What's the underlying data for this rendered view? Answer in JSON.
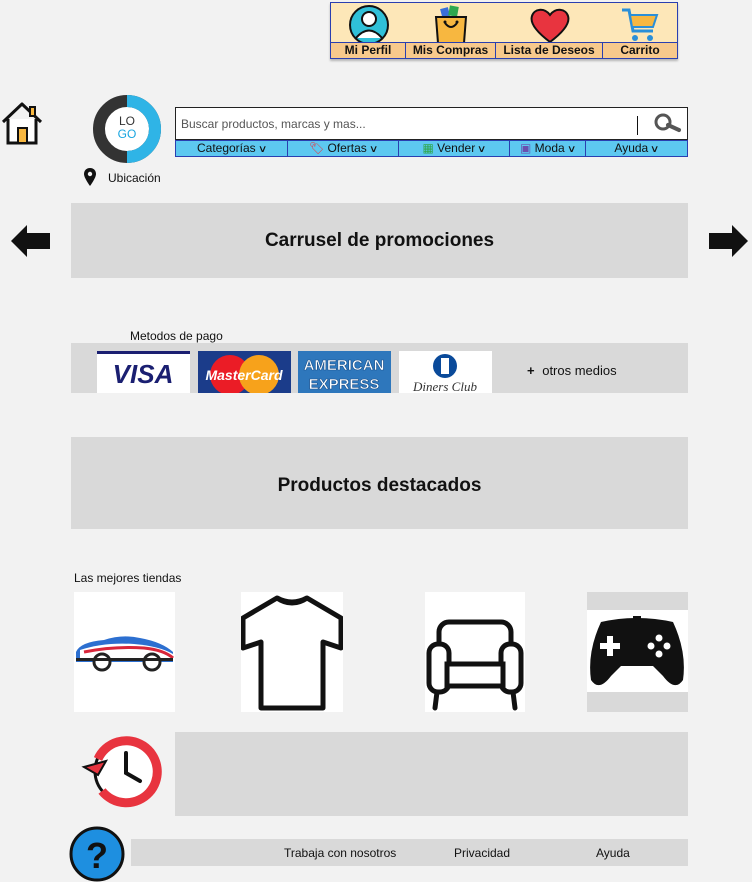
{
  "user_bar": {
    "profile": "Mi Perfil",
    "purchases": "Mis Compras",
    "wishlist": "Lista de Deseos",
    "cart": "Carrito"
  },
  "logo": {
    "line1": "LO",
    "line2": "GO"
  },
  "location": "Ubicación",
  "search": {
    "placeholder": "Buscar productos, marcas y mas..."
  },
  "nav": {
    "categories": "Categorías",
    "offers": "Ofertas",
    "sell": "Vender",
    "fashion": "Moda",
    "help": "Ayuda"
  },
  "carousel": {
    "title": "Carrusel de promociones"
  },
  "payment": {
    "label": "Metodos de pago",
    "cards": [
      "VISA",
      "MasterCard",
      "AMERICAN EXPRESS",
      "Diners Club"
    ],
    "more": "otros medios"
  },
  "featured": {
    "title": "Productos destacados"
  },
  "stores": {
    "label": "Las mejores tiendas"
  },
  "footer": {
    "work": "Trabaja con nosotros",
    "privacy": "Privacidad",
    "help": "Ayuda"
  },
  "colors": {
    "accent_blue": "#5dc8f0",
    "peach": "#fde7b8",
    "border_blue": "#2a3fb0",
    "panel_gray": "#d9d9d9"
  }
}
